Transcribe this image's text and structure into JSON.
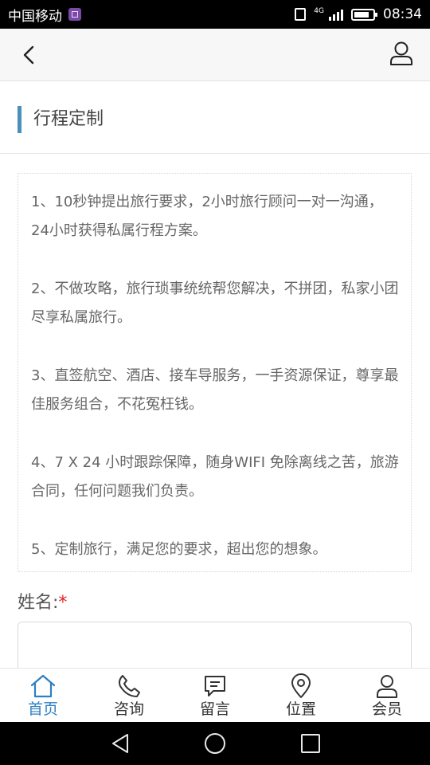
{
  "status_bar": {
    "carrier": "中国移动",
    "network": "4G",
    "time": "08:34"
  },
  "header": {
    "back_icon": "chevron-left-icon",
    "user_icon": "user-icon"
  },
  "section": {
    "title": "行程定制",
    "accent_color": "#4a90b8"
  },
  "info": {
    "items": [
      "1、10秒钟提出旅行要求，2小时旅行顾问一对一沟通，24小时获得私属行程方案。",
      "2、不做攻略，旅行琐事统统帮您解决，不拼团，私家小团尽享私属旅行。",
      "3、直签航空、酒店、接车导服务，一手资源保证，尊享最佳服务组合，不花冤枉钱。",
      "4、7 X 24 小时跟踪保障，随身WIFI 免除离线之苦，旅游合同，任何问题我们负责。",
      "5、定制旅行，满足您的要求，超出您的想象。"
    ]
  },
  "form": {
    "name_label": "姓名:",
    "required_mark": "*",
    "name_value": ""
  },
  "bottom_nav": {
    "items": [
      {
        "label": "首页",
        "icon": "home-icon",
        "active": true
      },
      {
        "label": "咨询",
        "icon": "phone-icon",
        "active": false
      },
      {
        "label": "留言",
        "icon": "message-icon",
        "active": false
      },
      {
        "label": "位置",
        "icon": "location-icon",
        "active": false
      },
      {
        "label": "会员",
        "icon": "member-icon",
        "active": false
      }
    ],
    "active_color": "#2f7fc1"
  },
  "system_nav": {
    "buttons": [
      "back-triangle-icon",
      "home-circle-icon",
      "recents-square-icon"
    ]
  }
}
